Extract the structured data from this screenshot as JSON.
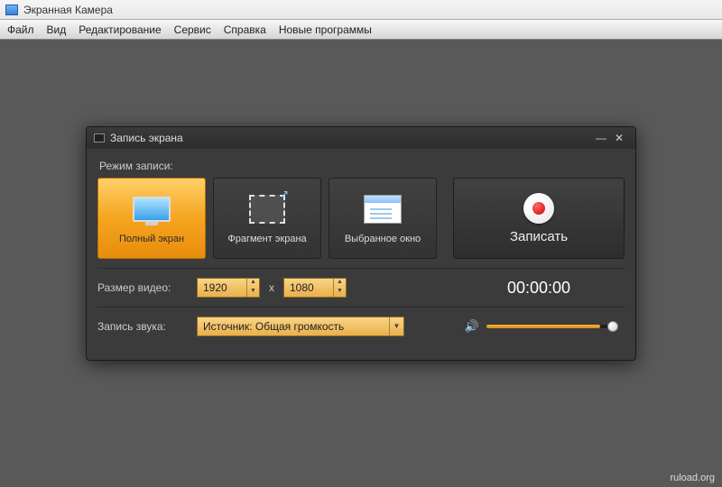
{
  "app": {
    "title": "Экранная Камера"
  },
  "menu": {
    "file": "Файл",
    "view": "Вид",
    "edit": "Редактирование",
    "service": "Сервис",
    "help": "Справка",
    "new_programs": "Новые программы"
  },
  "dialog": {
    "title": "Запись экрана",
    "mode_label": "Режим записи:",
    "modes": {
      "full": "Полный экран",
      "fragment": "Фрагмент экрана",
      "window": "Выбранное окно"
    },
    "record_label": "Записать",
    "size_label": "Размер видео:",
    "width": "1920",
    "height": "1080",
    "separator": "x",
    "timer": "00:00:00",
    "audio_label": "Запись звука:",
    "audio_source": "Источник: Общая громкость"
  },
  "watermark": "ruload.org"
}
